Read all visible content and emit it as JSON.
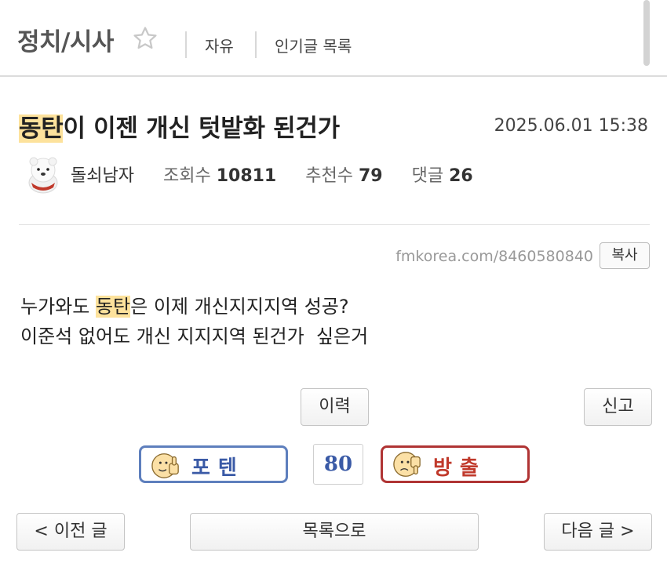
{
  "header": {
    "board_title": "정치/시사",
    "nav": [
      "자유",
      "인기글 목록"
    ]
  },
  "post": {
    "title_highlight": "동탄",
    "title_rest": "이 이젠 개신 텃밭화 된건가",
    "date": "2025.06.01 15:38",
    "author": "돌쇠남자",
    "views_label": "조회수",
    "views": "10811",
    "recommends_label": "추천수",
    "recommends": "79",
    "comments_label": "댓글",
    "comments": "26",
    "url": "fmkorea.com/8460580840",
    "copy_label": "복사",
    "body_line1_pre": "누가와도 ",
    "body_line1_highlight": "동탄",
    "body_line1_post": "은 이제 개신지지지역 성공?",
    "body_line2": "이준석 없어도 개신 지지지역 된건가  싶은거"
  },
  "actions": {
    "history_label": "이력",
    "report_label": "신고",
    "upvote_label": "포텐",
    "vote_count": "80",
    "downvote_label": "방출",
    "prev_label": "< 이전 글",
    "list_label": "목록으로",
    "next_label": "다음 글 >"
  },
  "colors": {
    "highlight": "#fde29c",
    "upvote_border": "#5e7fbd",
    "downvote_border": "#b03434",
    "vote_count": "#3a5aa6"
  },
  "icons": {
    "favorite": "star-outline-icon",
    "upvote": "thumbs-up-face-icon",
    "downvote": "thumbs-down-face-icon"
  }
}
